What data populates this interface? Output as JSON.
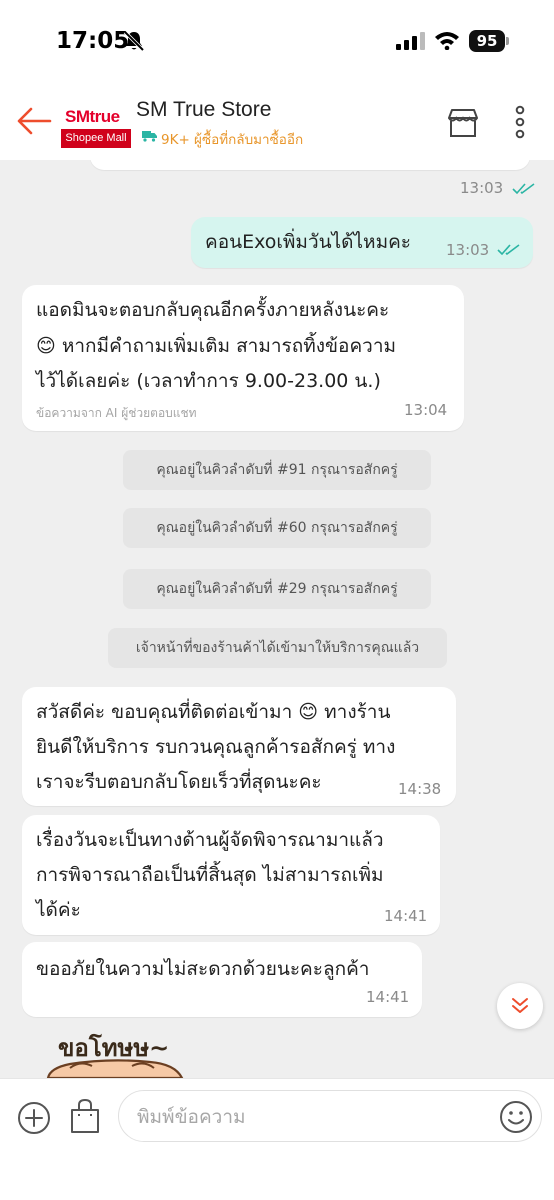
{
  "status_bar": {
    "time": "17:05",
    "battery": "95"
  },
  "header": {
    "store_name": "SM True Store",
    "logo_brand": "SMtrue",
    "logo_badge": "Shopee Mall",
    "subtitle": "9K+ ผู้ซื้อที่กลับมาซื้ออีก"
  },
  "messages": [
    {
      "from": "store",
      "time": "13:03"
    },
    {
      "from": "user",
      "text": "คอนExoเพิ่มวันได้ไหมคะ",
      "time": "13:03"
    },
    {
      "from": "store",
      "lines": [
        "แอดมินจะตอบกลับคุณอีกครั้งภายหลังนะคะ",
        "😊 หากมีคำถามเพิ่มเติม สามารถทิ้งข้อความ",
        "ไว้ได้เลยค่ะ (เวลาทำการ 9.00-23.00 น.)"
      ],
      "note": "ข้อความจาก AI ผู้ช่วยตอบแชท",
      "time": "13:04"
    },
    {
      "from": "system",
      "text": "คุณอยู่ในคิวลำดับที่ #91 กรุณารอสักครู่"
    },
    {
      "from": "system",
      "text": "คุณอยู่ในคิวลำดับที่ #60 กรุณารอสักครู่"
    },
    {
      "from": "system",
      "text": "คุณอยู่ในคิวลำดับที่ #29 กรุณารอสักครู่"
    },
    {
      "from": "system",
      "text": "เจ้าหน้าที่ของร้านค้าได้เข้ามาให้บริการคุณแล้ว"
    },
    {
      "from": "store",
      "lines": [
        "สวัสดีค่ะ ขอบคุณที่ติดต่อเข้ามา 😊 ทางร้าน",
        "ยินดีให้บริการ รบกวนคุณลูกค้ารอสักครู่ ทาง",
        "เราจะรีบตอบกลับโดยเร็วที่สุดนะคะ"
      ],
      "time": "14:38"
    },
    {
      "from": "store",
      "lines": [
        "เรื่องวันจะเป็นทางด้านผู้จัดพิจารณามาแล้ว",
        "การพิจารณาถือเป็นที่สิ้นสุด ไม่สามารถเพิ่ม",
        "ได้ค่ะ"
      ],
      "time": "14:41"
    },
    {
      "from": "store",
      "lines": [
        "ขออภัยในความไม่สะดวกด้วยนะคะลูกค้า"
      ],
      "time": "14:41"
    },
    {
      "from": "store",
      "sticker_text": "ขอโทษษ~"
    }
  ],
  "composer": {
    "placeholder": "พิมพ์ข้อความ"
  },
  "colors": {
    "accent": "#ee4d2d",
    "user_bubble": "#d6f5ef",
    "read_check": "#2bb5a4",
    "subtitle": "#e8962b"
  }
}
